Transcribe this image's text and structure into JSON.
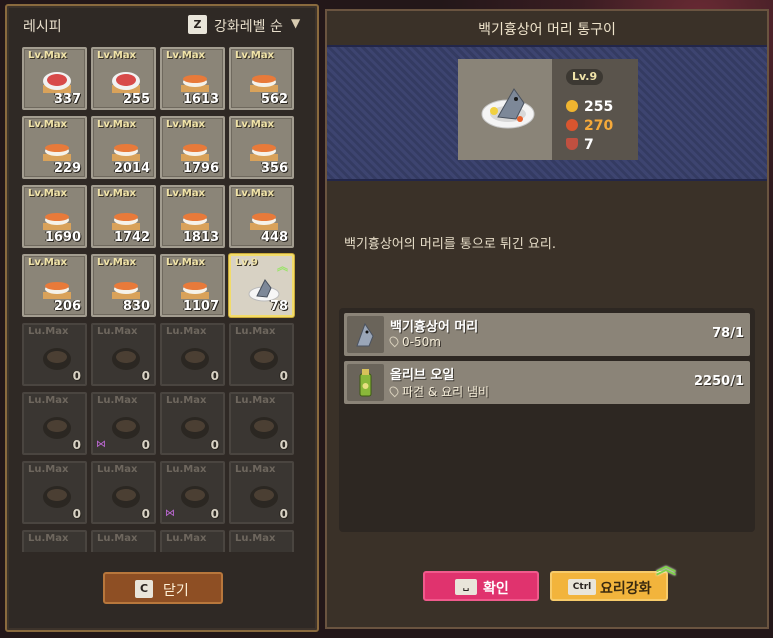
{
  "left": {
    "title": "레시피",
    "sort_key": "Z",
    "sort_label": "강화레벨 순",
    "close_key": "C",
    "close_label": "닫기"
  },
  "recipes": [
    {
      "level": "Lv.Max",
      "count": "337",
      "state": "owned",
      "dish": "sushi-plate"
    },
    {
      "level": "Lv.Max",
      "count": "255",
      "state": "owned",
      "dish": "sushi-plate"
    },
    {
      "level": "Lv.Max",
      "count": "1613",
      "state": "owned",
      "dish": "sushi"
    },
    {
      "level": "Lv.Max",
      "count": "562",
      "state": "owned",
      "dish": "sushi"
    },
    {
      "level": "Lv.Max",
      "count": "229",
      "state": "owned",
      "dish": "sushi"
    },
    {
      "level": "Lv.Max",
      "count": "2014",
      "state": "owned",
      "dish": "sushi"
    },
    {
      "level": "Lv.Max",
      "count": "1796",
      "state": "owned",
      "dish": "sushi"
    },
    {
      "level": "Lv.Max",
      "count": "356",
      "state": "owned",
      "dish": "sushi"
    },
    {
      "level": "Lv.Max",
      "count": "1690",
      "state": "owned",
      "dish": "sushi"
    },
    {
      "level": "Lv.Max",
      "count": "1742",
      "state": "owned",
      "dish": "sushi"
    },
    {
      "level": "Lv.Max",
      "count": "1813",
      "state": "owned",
      "dish": "sushi"
    },
    {
      "level": "Lv.Max",
      "count": "448",
      "state": "owned",
      "dish": "sushi"
    },
    {
      "level": "Lv.Max",
      "count": "206",
      "state": "owned",
      "dish": "sushi"
    },
    {
      "level": "Lv.Max",
      "count": "830",
      "state": "owned",
      "dish": "sushi"
    },
    {
      "level": "Lv.Max",
      "count": "1107",
      "state": "owned",
      "dish": "sushi"
    },
    {
      "level": "Lv.9",
      "count": "78",
      "state": "selected",
      "dish": "fish-head"
    },
    {
      "level": "Lu.Max",
      "count": "0",
      "state": "locked",
      "dish": "bowl"
    },
    {
      "level": "Lu.Max",
      "count": "0",
      "state": "locked",
      "dish": "bowl"
    },
    {
      "level": "Lu.Max",
      "count": "0",
      "state": "locked",
      "dish": "bowl"
    },
    {
      "level": "Lu.Max",
      "count": "0",
      "state": "locked",
      "dish": "bowl"
    },
    {
      "level": "Lu.Max",
      "count": "0",
      "state": "locked",
      "dish": "bowl"
    },
    {
      "level": "Lu.Max",
      "count": "0",
      "state": "locked",
      "dish": "bowl"
    },
    {
      "level": "Lu.Max",
      "count": "0",
      "state": "locked",
      "dish": "bowl"
    },
    {
      "level": "Lu.Max",
      "count": "0",
      "state": "locked",
      "dish": "bowl"
    },
    {
      "level": "Lu.Max",
      "count": "0",
      "state": "locked",
      "dish": "bowl"
    },
    {
      "level": "Lu.Max",
      "count": "0",
      "state": "locked",
      "dish": "bowl"
    },
    {
      "level": "Lu.Max",
      "count": "0",
      "state": "locked",
      "dish": "bowl"
    },
    {
      "level": "Lu.Max",
      "count": "0",
      "state": "locked",
      "dish": "bowl"
    },
    {
      "level": "Lu.Max",
      "count": "",
      "state": "locked",
      "dish": "bowl"
    },
    {
      "level": "Lu.Max",
      "count": "",
      "state": "locked",
      "dish": "bowl"
    },
    {
      "level": "Lu.Max",
      "count": "",
      "state": "locked",
      "dish": "bowl"
    },
    {
      "level": "Lu.Max",
      "count": "",
      "state": "locked",
      "dish": "bowl"
    }
  ],
  "detail": {
    "title": "백기흉상어 머리 통구이",
    "level": "Lv.9",
    "price": "255",
    "taste": "270",
    "servings": "7",
    "description": "백기흉상어의 머리를 통으로 튀긴 요리."
  },
  "ingredients": [
    {
      "name": "백기흉상어 머리",
      "location": "0-50m",
      "qty": "78/1",
      "icon": "shark-head-icon"
    },
    {
      "name": "올리브 오일",
      "location": "파견 & 요리 냄비",
      "qty": "2250/1",
      "icon": "olive-oil-icon"
    }
  ],
  "actions": {
    "confirm_key": "␣",
    "confirm_label": "확인",
    "upgrade_key": "Ctrl",
    "upgrade_label": "요리강화"
  },
  "colors": {
    "panel": "#2f2925",
    "banner": "#3d4470",
    "confirm": "#e0336e",
    "upgrade": "#f2b43c"
  }
}
